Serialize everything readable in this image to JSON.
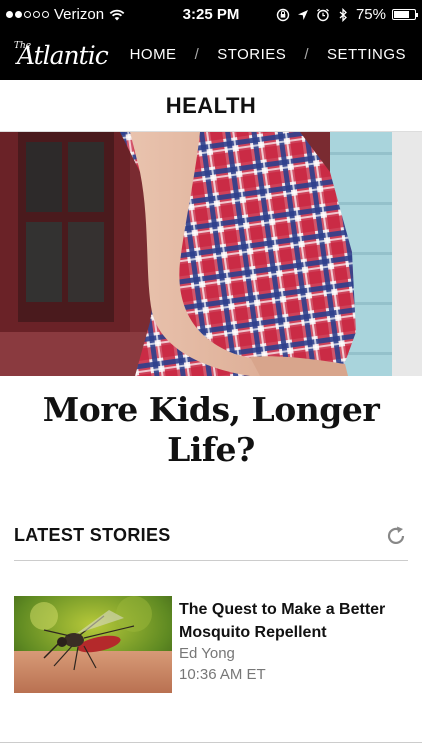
{
  "status_bar": {
    "carrier": "Verizon",
    "time": "3:25 PM",
    "battery": "75%",
    "battery_level": 0.75,
    "signal_bars_filled": 2,
    "signal_bars_total": 5
  },
  "nav": {
    "logo_the": "The",
    "logo_name": "Atlantic",
    "items": [
      {
        "label": "HOME"
      },
      {
        "label": "STORIES"
      },
      {
        "label": "SETTINGS"
      }
    ],
    "separator": "/"
  },
  "section": {
    "title": "HEALTH"
  },
  "hero": {
    "headline": "More Kids, Longer Life?"
  },
  "latest": {
    "label": "LATEST STORIES"
  },
  "stories": [
    {
      "title": "The Quest to Make a Better Mosquito Repellent",
      "author": "Ed Yong",
      "time": "10:36 AM ET"
    }
  ],
  "icons": {
    "wifi": "wifi-icon",
    "lock": "rotation-lock-icon",
    "location": "location-arrow-icon",
    "alarm": "alarm-clock-icon",
    "bluetooth": "bluetooth-icon",
    "battery": "battery-icon",
    "refresh": "refresh-icon"
  },
  "colors": {
    "nav_bg": "#000000",
    "text": "#111111",
    "meta": "#777777"
  }
}
